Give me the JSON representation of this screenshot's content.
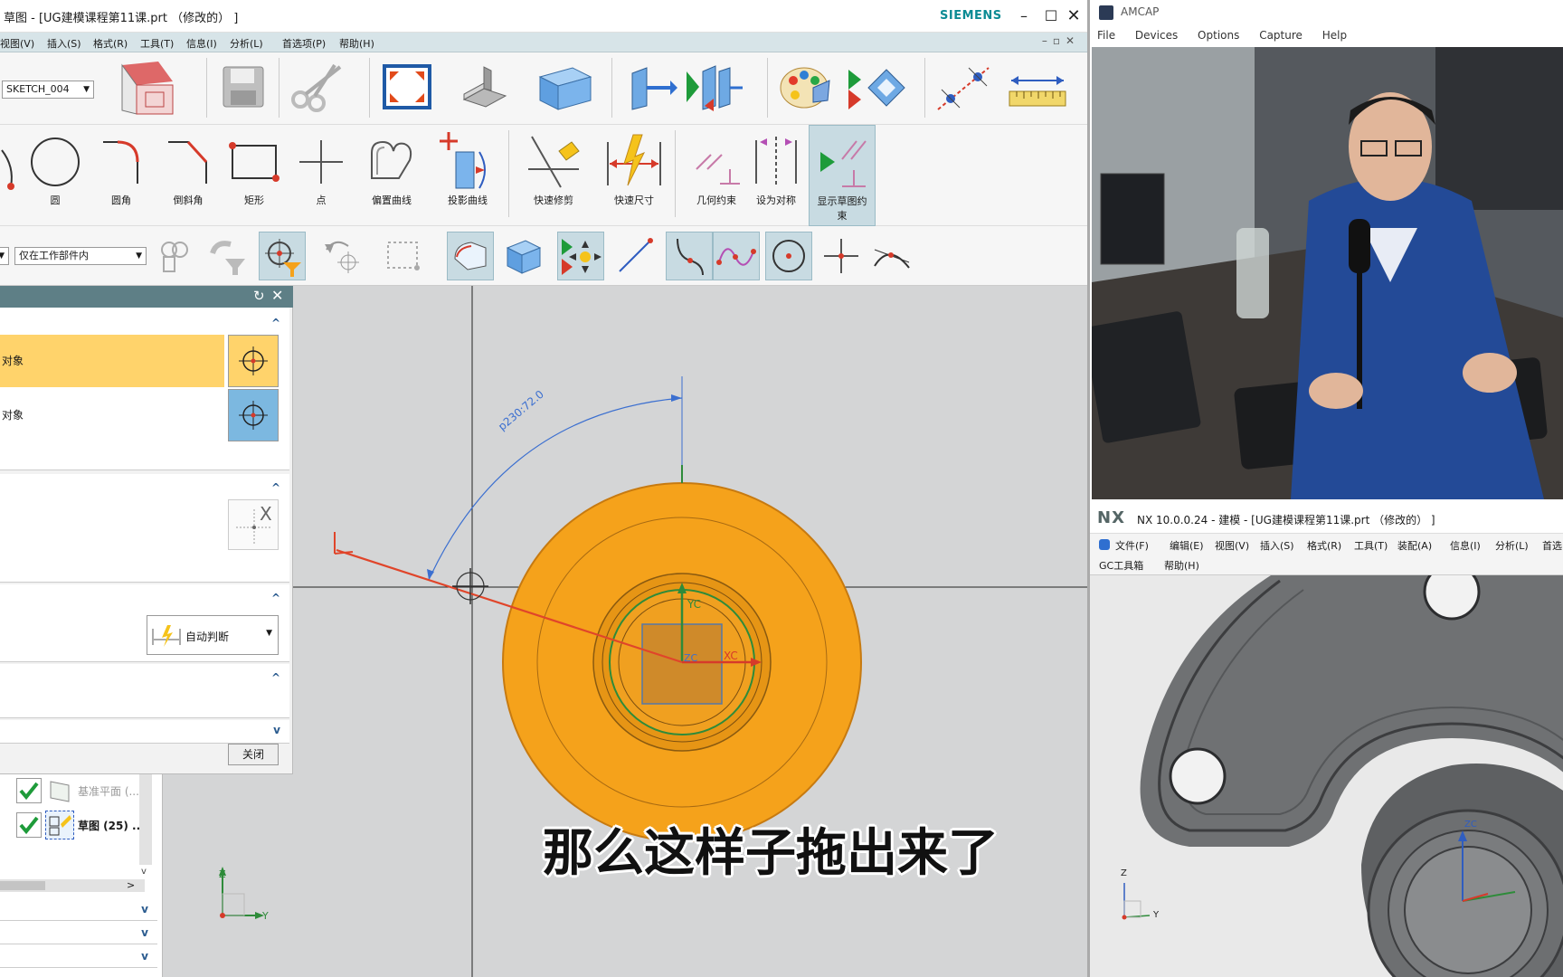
{
  "main": {
    "title": "草图 - [UG建模课程第11课.prt （修改的） ]",
    "brand": "SIEMENS",
    "menu": [
      "视图(V)",
      "插入(S)",
      "格式(R)",
      "工具(T)",
      "信息(I)",
      "分析(L)",
      "首选项(P)",
      "帮助(H)"
    ],
    "sketch_combo": "SKETCH_004",
    "filter_combo": "仅在工作部件内",
    "tools": {
      "circle": "圆",
      "fillet": "圆角",
      "chamfer": "倒斜角",
      "rectangle": "矩形",
      "point": "点",
      "offset_curve": "偏置曲线",
      "project_curve": "投影曲线",
      "quick_trim": "快速修剪",
      "quick_dimension": "快速尺寸",
      "geometric_constraints": "几何约束",
      "make_symmetric": "设为对称",
      "show_constraints": "显示草图约",
      "show_constraints_2": "束"
    }
  },
  "dialog": {
    "row1": "对象",
    "row2": "对象",
    "method": "自动判断",
    "close": "关闭"
  },
  "navtree": {
    "item1": "基准平面 (...",
    "item2": "草图 (25) ..."
  },
  "viewport": {
    "dimension": "p230:72.0",
    "yc": "YC",
    "xc": "XC",
    "zc": "ZC",
    "triad_z": "Z",
    "triad_y": "Y"
  },
  "caption": "那么这样子拖出来了",
  "amcap": {
    "title": "AMCAP",
    "menu": [
      "File",
      "Devices",
      "Options",
      "Capture",
      "Help"
    ]
  },
  "nx2": {
    "logo": "NX",
    "title": "NX 10.0.0.24 - 建模 - [UG建模课程第11课.prt （修改的） ]",
    "menu": [
      "文件(F)",
      "编辑(E)",
      "视图(V)",
      "插入(S)",
      "格式(R)",
      "工具(T)",
      "装配(A)",
      "信息(I)",
      "分析(L)",
      "首选"
    ],
    "menu2": [
      "GC工具箱",
      "帮助(H)"
    ],
    "zc": "ZC",
    "triad_z": "Z",
    "triad_y": "Y"
  },
  "colors": {
    "accent_brand": "#0b8b94",
    "part_orange": "#f5a21b",
    "selection_yellow": "#ffd36b",
    "selection_blue": "#7cb8e0",
    "dialog_header": "#5e7f86",
    "dimension_blue": "#3b6fd0",
    "drag_red": "#e0452a"
  }
}
